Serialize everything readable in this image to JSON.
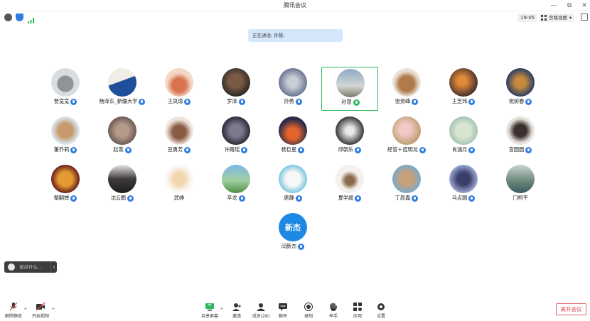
{
  "window": {
    "title": "腾讯会议",
    "minimize_glyph": "—",
    "restore_glyph": "⧉",
    "close_glyph": "✕"
  },
  "status": {
    "clock": "19:05",
    "view_label": "宫格视图",
    "view_caret": "▾",
    "icons": [
      "info-icon",
      "shield-icon",
      "signal-icon"
    ]
  },
  "speaking": {
    "text": "正在讲话: 孙慧;"
  },
  "participants": [
    {
      "name": "普宽宽",
      "mic": "on"
    },
    {
      "name": "杨泽东_新疆大学",
      "mic": "on"
    },
    {
      "name": "王凤逸",
      "mic": "on"
    },
    {
      "name": "罗泽",
      "mic": "on"
    },
    {
      "name": "孙勇",
      "mic": "on"
    },
    {
      "name": "孙慧",
      "mic": "talking",
      "active": true
    },
    {
      "name": "张资峰",
      "mic": "on"
    },
    {
      "name": "王芝炜",
      "mic": "on"
    },
    {
      "name": "祝树春",
      "mic": "on"
    },
    {
      "name": "董乔莉",
      "mic": "on"
    },
    {
      "name": "赵燕",
      "mic": "on"
    },
    {
      "name": "豆勇芳",
      "mic": "on"
    },
    {
      "name": "许路瑶",
      "mic": "on"
    },
    {
      "name": "杨巨星",
      "mic": "on"
    },
    {
      "name": "邱朝乐",
      "mic": "on"
    },
    {
      "name": "经管＋庞明龙",
      "mic": "on"
    },
    {
      "name": "肖涵月",
      "mic": "on"
    },
    {
      "name": "宫圆圆",
      "mic": "on"
    },
    {
      "name": "黎嗣婵",
      "mic": "on"
    },
    {
      "name": "沈云鹏",
      "mic": "on"
    },
    {
      "name": "武峥",
      "mic": "none"
    },
    {
      "name": "辛龙",
      "mic": "on"
    },
    {
      "name": "唐静",
      "mic": "on"
    },
    {
      "name": "夏学超",
      "mic": "on"
    },
    {
      "name": "丁辰鑫",
      "mic": "on"
    },
    {
      "name": "马点圆",
      "mic": "on"
    },
    {
      "name": "门柯平",
      "mic": "none"
    },
    {
      "name": "闫新杰",
      "mic": "on",
      "initials": "新杰"
    }
  ],
  "chat": {
    "placeholder": "说点什么...",
    "collapse": "‹"
  },
  "toolbar": {
    "left": [
      {
        "label": "解除静音",
        "icon": "mic-muted-icon"
      },
      {
        "label": "开启视频",
        "icon": "video-off-icon"
      }
    ],
    "center": [
      {
        "label": "共享屏幕",
        "icon": "share-screen-icon"
      },
      {
        "label": "邀请",
        "icon": "invite-icon"
      },
      {
        "label": "成员(28)",
        "icon": "members-icon"
      },
      {
        "label": "聊天",
        "icon": "chat-icon"
      },
      {
        "label": "录制",
        "icon": "record-icon"
      },
      {
        "label": "举手",
        "icon": "raise-hand-icon"
      },
      {
        "label": "应用",
        "icon": "apps-icon"
      },
      {
        "label": "设置",
        "icon": "settings-icon"
      }
    ],
    "caret": "^",
    "leave_label": "离开会议"
  },
  "colors": {
    "active_border": "#2dba5c",
    "mic_blue": "#2f7de1",
    "leave_red": "#e04545",
    "toast_bg": "#d4e7fb"
  }
}
